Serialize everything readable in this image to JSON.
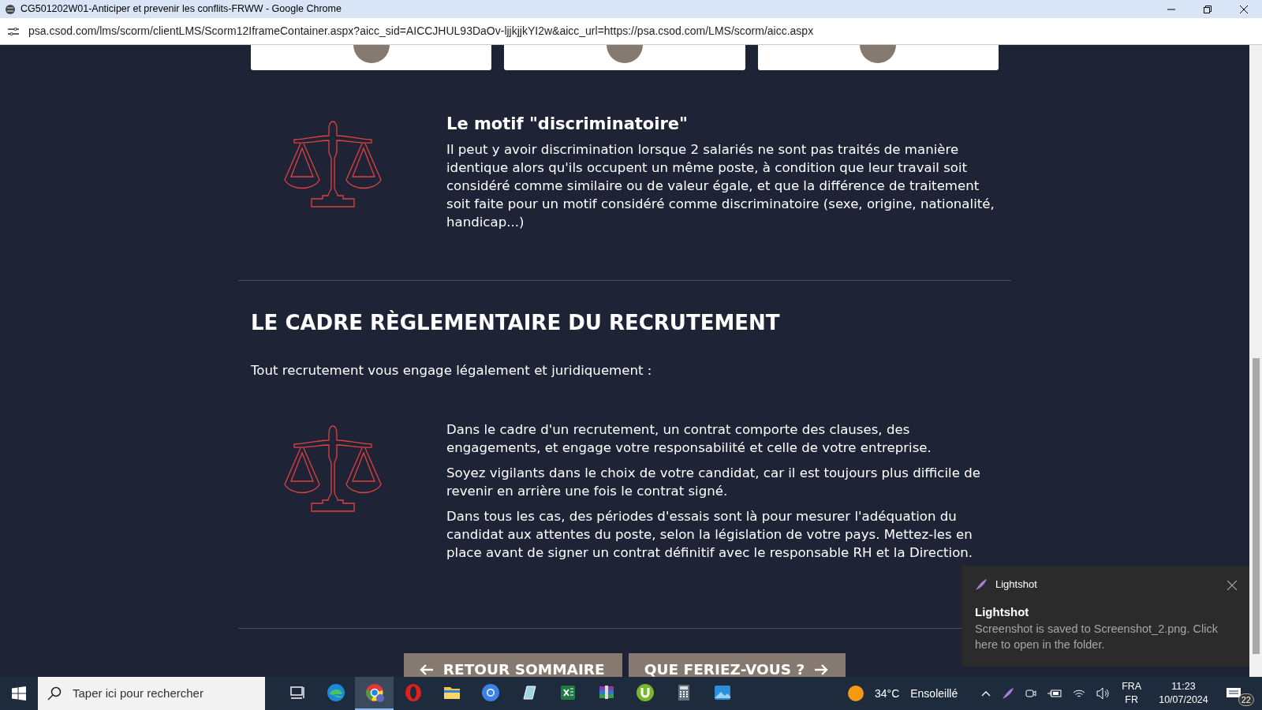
{
  "window": {
    "title": "CG501202W01-Anticiper et prevenir les conflits-FRWW - Google Chrome"
  },
  "address_bar": {
    "url": "psa.csod.com/lms/scorm/clientLMS/Scorm12IframeContainer.aspx?aicc_sid=AICCJHUL93DaOv-ljjkjjkYI2w&aicc_url=https://psa.csod.com/LMS/scorm/aicc.aspx"
  },
  "content": [
    {
      "kind": "feature",
      "title": "Le motif \"discriminatoire\"",
      "paragraphs": [
        "Il peut y avoir discrimination lorsque 2 salariés ne sont pas traités de manière identique alors qu'ils occupent un même poste, à condition que leur travail soit considéré comme similaire ou de valeur égale, et que la différence de traitement soit faite pour un motif considéré comme discriminatoire (sexe, origine, nationalité, handicap...)"
      ]
    },
    {
      "kind": "divider"
    },
    {
      "kind": "heading",
      "text": "LE CADRE RÈGLEMENTAIRE DU RECRUTEMENT"
    },
    {
      "kind": "lead",
      "text": "Tout recrutement vous engage légalement et juridiquement :"
    },
    {
      "kind": "feature",
      "paragraphs": [
        "Dans le cadre d'un recrutement, un contrat comporte des clauses, des engagements, et engage votre responsabilité et celle de votre entreprise.",
        "Soyez vigilants dans le choix de votre candidat, car il est toujours plus difficile de revenir en arrière une fois le contrat signé.",
        "Dans tous les cas, des périodes d'essais sont là pour mesurer l'adéquation du candidat aux attentes du poste, selon la législation de votre pays. Mettez-les en place avant de signer un contrat définitif avec le responsable RH et la Direction."
      ]
    },
    {
      "kind": "divider"
    }
  ],
  "nav_buttons": [
    {
      "kind": "back",
      "label": "RETOUR SOMMAIRE"
    },
    {
      "kind": "next",
      "label": "QUE FERIEZ-VOUS ?"
    }
  ],
  "notification": {
    "app": "Lightshot",
    "title": "Lightshot",
    "message": "Screenshot is saved to Screenshot_2.png. Click here to open in the folder."
  },
  "taskbar": {
    "search_placeholder": "Taper ici pour rechercher",
    "apps": [
      {
        "kind": "taskview",
        "active": false
      },
      {
        "kind": "edge",
        "active": false
      },
      {
        "kind": "chrome",
        "active": true
      },
      {
        "kind": "opera",
        "active": false
      },
      {
        "kind": "folder",
        "active": false
      },
      {
        "kind": "chromium",
        "active": false
      },
      {
        "kind": "notepad",
        "active": false
      },
      {
        "kind": "excel",
        "active": false
      },
      {
        "kind": "archive",
        "active": false
      },
      {
        "kind": "torrent",
        "active": false
      },
      {
        "kind": "calculator",
        "active": false
      },
      {
        "kind": "photos",
        "active": false
      }
    ],
    "weather": {
      "temperature": "34°C",
      "condition": "Ensoleillé"
    },
    "language": "FRA",
    "layout": "FR",
    "time": "11:23",
    "date": "10/07/2024",
    "notification_count": "22"
  }
}
